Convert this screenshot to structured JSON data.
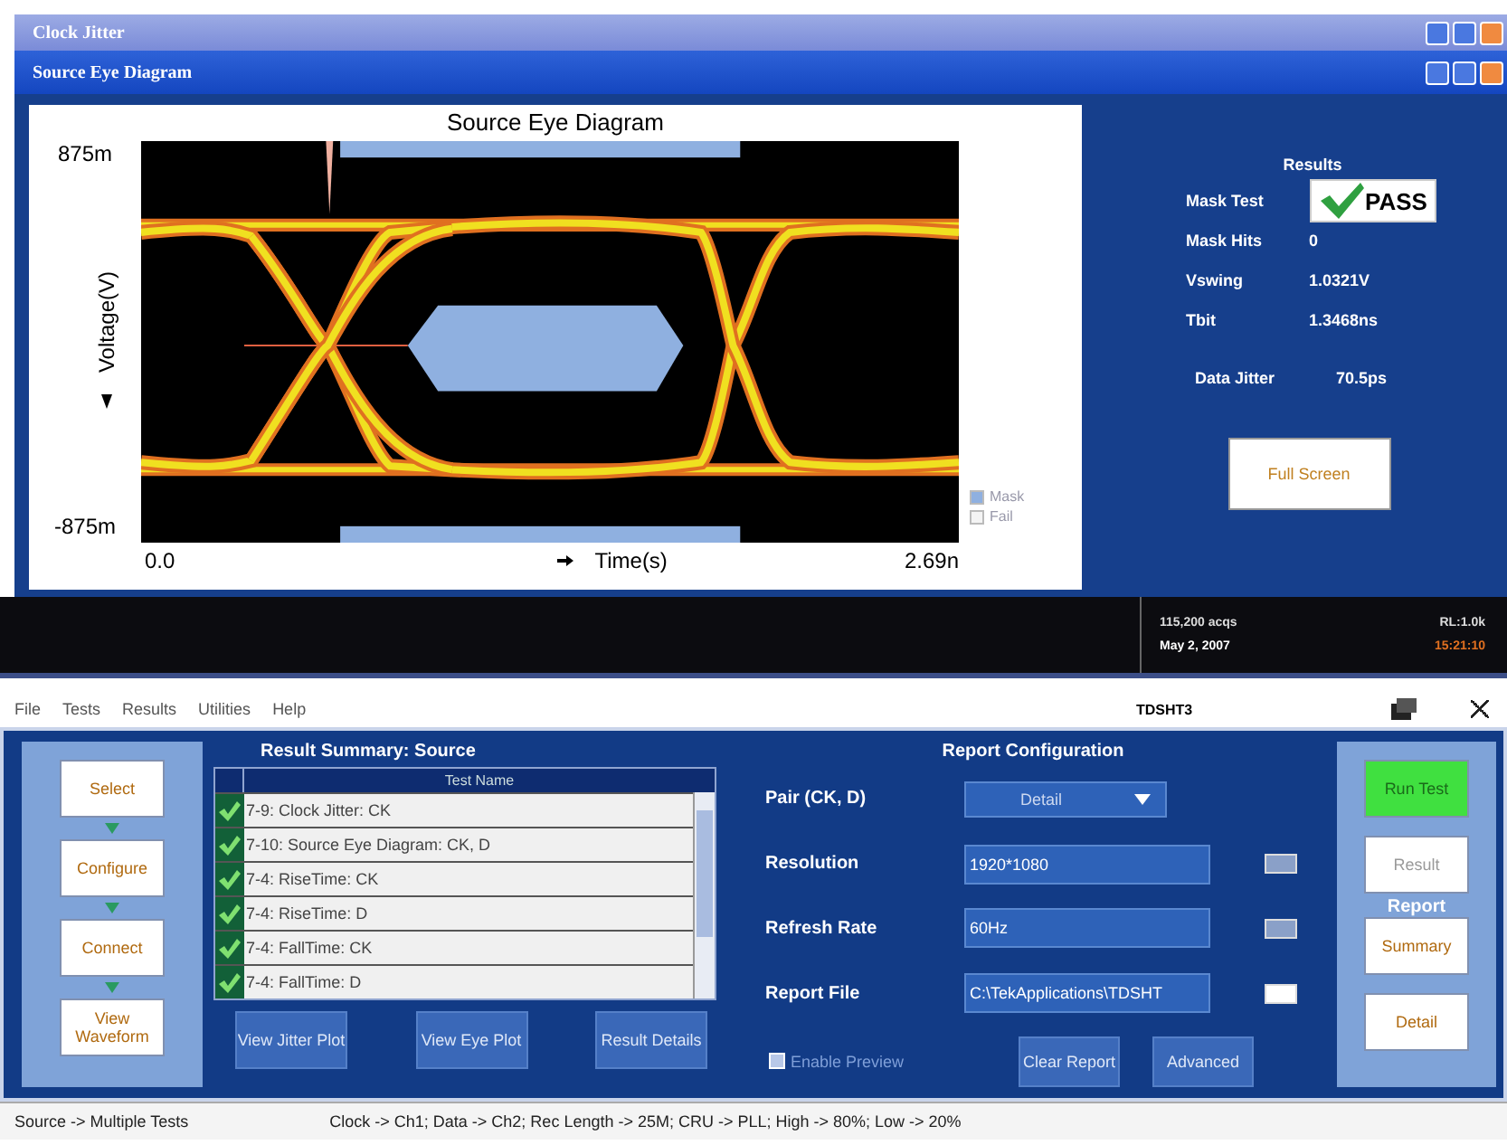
{
  "title_bars": [
    {
      "title": "Clock Jitter"
    },
    {
      "title": "Source Eye Diagram"
    }
  ],
  "plot": {
    "title": "Source Eye Diagram",
    "y_max": "875m",
    "y_min": "-875m",
    "x_min": "0.0",
    "x_max": "2.69n",
    "xlabel": "Time(s)",
    "ylabel": "Voltage(V)",
    "legend": [
      {
        "label": "Mask",
        "color": "#8fb0e0"
      },
      {
        "label": "Fail",
        "color": "#f4f4f4"
      }
    ]
  },
  "results": {
    "title": "Results",
    "rows": [
      {
        "label": "Mask Test",
        "value": "PASS",
        "kind": "badge"
      },
      {
        "label": "Mask Hits",
        "value": "0",
        "kind": "text"
      },
      {
        "label": "Vswing",
        "value": "1.0321V",
        "kind": "text"
      },
      {
        "label": "Tbit",
        "value": "1.3468ns",
        "kind": "text"
      }
    ],
    "data_jitter": {
      "label": "Data Jitter",
      "value": "70.5ps"
    },
    "button": "Full Screen"
  },
  "scope_status": {
    "acquisitions": "115,200 acqs",
    "record_length": "RL:1.0k",
    "date": "May 2, 2007",
    "time": "15:21:10"
  },
  "menu": [
    "File",
    "Tests",
    "Results",
    "Utilities",
    "Help"
  ],
  "app_name": "TDSHT3",
  "nav": [
    {
      "label": "Select"
    },
    {
      "label": "Configure"
    },
    {
      "label": "Connect"
    },
    {
      "label": "View Waveform"
    }
  ],
  "summary": {
    "title": "Result Summary: Source",
    "column": "Test Name",
    "rows": [
      {
        "name": "7-9: Clock Jitter: CK",
        "passed": true
      },
      {
        "name": "7-10: Source Eye Diagram: CK, D",
        "passed": true
      },
      {
        "name": "7-4: RiseTime: CK",
        "passed": true
      },
      {
        "name": "7-4: RiseTime: D",
        "passed": true
      },
      {
        "name": "7-4: FallTime: CK",
        "passed": true
      },
      {
        "name": "7-4: FallTime: D",
        "passed": true
      }
    ],
    "buttons": [
      "View Jitter Plot",
      "View Eye Plot",
      "Result Details"
    ]
  },
  "report": {
    "title": "Report Configuration",
    "fields": [
      {
        "label": "Pair (CK, D)",
        "value": "Detail",
        "kind": "dropdown"
      },
      {
        "label": "Resolution",
        "value": "1920*1080",
        "kind": "text"
      },
      {
        "label": "Refresh Rate",
        "value": "60Hz",
        "kind": "text"
      },
      {
        "label": "Report File",
        "value": "C:\\TekApplications\\TDSHT",
        "kind": "file"
      }
    ],
    "enable_preview": {
      "label": "Enable Preview",
      "checked": false
    },
    "buttons": [
      "Clear Report",
      "Advanced"
    ]
  },
  "actions": [
    {
      "label": "Run Test",
      "kind": "run"
    },
    {
      "label": "Result",
      "kind": "button",
      "disabled": true
    },
    {
      "label": "Report",
      "kind": "heading"
    },
    {
      "label": "Summary",
      "kind": "button",
      "disabled": false
    },
    {
      "label": "Detail",
      "kind": "button",
      "disabled": false
    }
  ],
  "status_bar": [
    "Source -> Multiple Tests",
    "Clock -> Ch1; Data -> Ch2; Rec Length -> 25M; CRU -> PLL; High -> 80%; Low -> 20%"
  ]
}
